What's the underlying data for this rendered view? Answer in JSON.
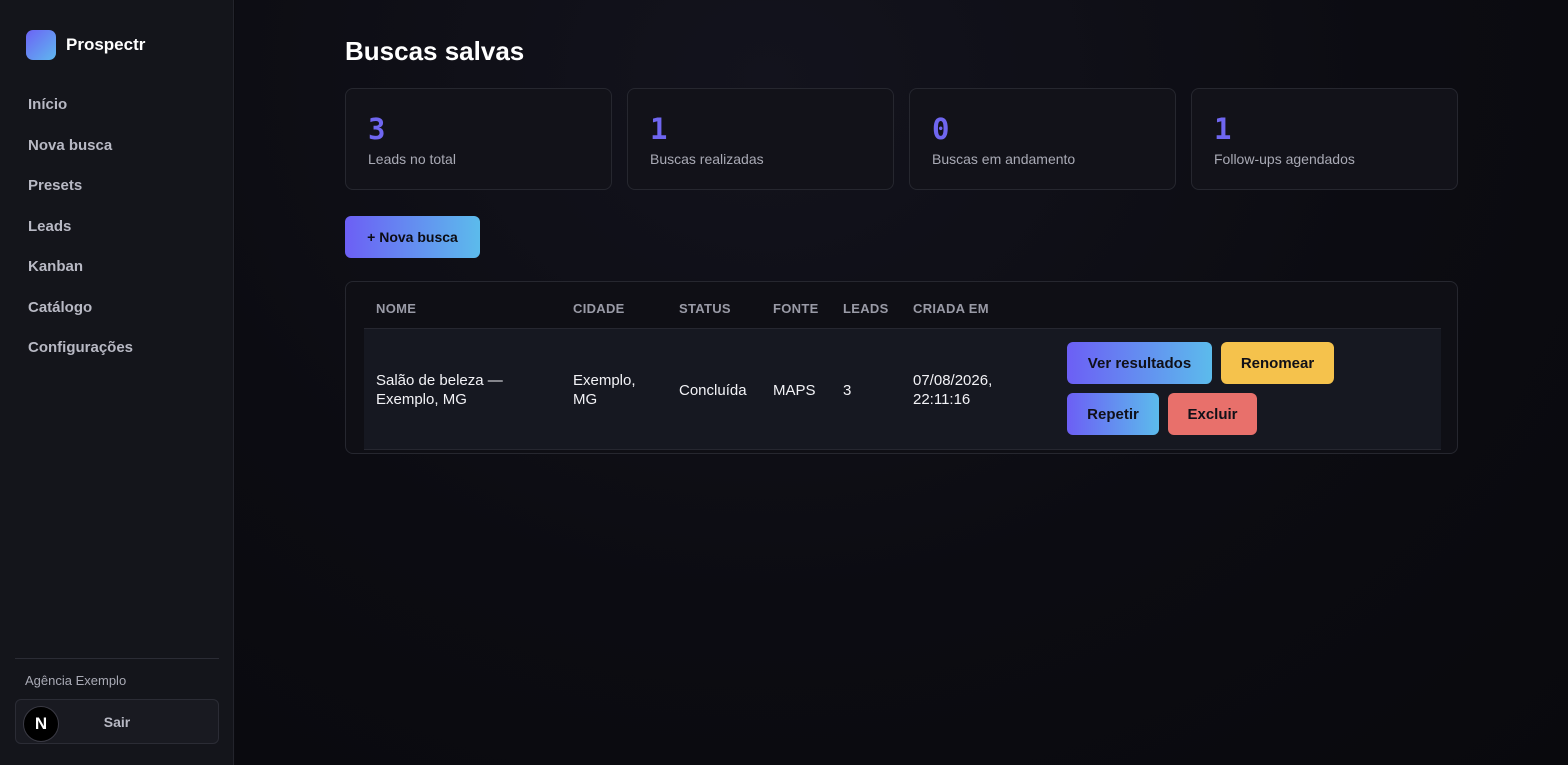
{
  "app": {
    "name": "Prospectr"
  },
  "sidebar": {
    "items": [
      {
        "label": "Início"
      },
      {
        "label": "Nova busca"
      },
      {
        "label": "Presets"
      },
      {
        "label": "Leads"
      },
      {
        "label": "Kanban"
      },
      {
        "label": "Catálogo"
      },
      {
        "label": "Configurações"
      }
    ],
    "org_name": "Agência Exemplo",
    "logout_label": "Sair",
    "badge_letter": "N"
  },
  "page": {
    "title": "Buscas salvas"
  },
  "stats": [
    {
      "value": "3",
      "label": "Leads no total"
    },
    {
      "value": "1",
      "label": "Buscas realizadas"
    },
    {
      "value": "0",
      "label": "Buscas em andamento"
    },
    {
      "value": "1",
      "label": "Follow-ups agendados"
    }
  ],
  "new_search_label": "+ Nova busca",
  "table": {
    "headers": {
      "name": "NOME",
      "city": "CIDADE",
      "status": "STATUS",
      "source": "FONTE",
      "leads": "LEADS",
      "created": "CRIADA EM"
    },
    "rows": [
      {
        "name_line1": "Salão de beleza —",
        "name_line2": "Exemplo, MG",
        "city_line1": "Exemplo,",
        "city_line2": "MG",
        "status": "Concluída",
        "source": "MAPS",
        "leads": "3",
        "created_line1": "07/08/2026,",
        "created_line2": "22:11:16",
        "actions": {
          "view": "Ver resultados",
          "rename": "Renomear",
          "repeat": "Repetir",
          "delete": "Excluir"
        }
      }
    ]
  },
  "colors": {
    "accent": "#6f66f0",
    "gradient_start": "#6c5ff5",
    "gradient_end": "#5cbbec",
    "rename": "#f5c24c",
    "delete": "#e8706b"
  }
}
